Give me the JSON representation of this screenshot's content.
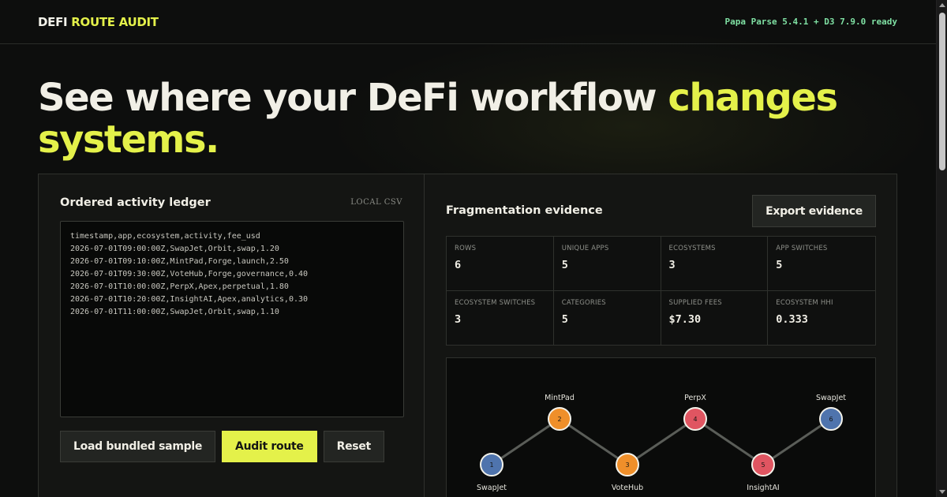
{
  "app": {
    "brand_prefix": "DEFI",
    "brand_accent": "ROUTE AUDIT",
    "library_status": "Papa Parse 5.4.1 + D3 7.9.0 ready"
  },
  "hero": {
    "headline_main": "See where your DeFi workflow ",
    "headline_accent": "changes systems."
  },
  "ledger": {
    "title": "Ordered activity ledger",
    "source_tag": "LOCAL CSV",
    "csv_text": "timestamp,app,ecosystem,activity,fee_usd\n2026-07-01T09:00:00Z,SwapJet,Orbit,swap,1.20\n2026-07-01T09:10:00Z,MintPad,Forge,launch,2.50\n2026-07-01T09:30:00Z,VoteHub,Forge,governance,0.40\n2026-07-01T10:00:00Z,PerpX,Apex,perpetual,1.80\n2026-07-01T10:20:00Z,InsightAI,Apex,analytics,0.30\n2026-07-01T11:00:00Z,SwapJet,Orbit,swap,1.10",
    "buttons": {
      "load_sample": "Load bundled sample",
      "audit": "Audit route",
      "reset": "Reset"
    }
  },
  "evidence": {
    "title": "Fragmentation evidence",
    "export_label": "Export evidence",
    "stats": [
      {
        "label": "ROWS",
        "value": "6"
      },
      {
        "label": "UNIQUE APPS",
        "value": "5"
      },
      {
        "label": "ECOSYSTEMS",
        "value": "3"
      },
      {
        "label": "APP SWITCHES",
        "value": "5"
      },
      {
        "label": "ECOSYSTEM SWITCHES",
        "value": "3"
      },
      {
        "label": "CATEGORIES",
        "value": "5"
      },
      {
        "label": "SUPPLIED FEES",
        "value": "$7.30"
      },
      {
        "label": "ECOSYSTEM HHI",
        "value": "0.333"
      }
    ]
  },
  "route": {
    "colors": {
      "Orbit": "#4f74ad",
      "Forge": "#ef8f2a",
      "Apex": "#e05561"
    },
    "steps": [
      {
        "n": "1",
        "app": "SwapJet",
        "ecosystem": "Orbit"
      },
      {
        "n": "2",
        "app": "MintPad",
        "ecosystem": "Forge"
      },
      {
        "n": "3",
        "app": "VoteHub",
        "ecosystem": "Forge"
      },
      {
        "n": "4",
        "app": "PerpX",
        "ecosystem": "Apex"
      },
      {
        "n": "5",
        "app": "InsightAI",
        "ecosystem": "Apex"
      },
      {
        "n": "6",
        "app": "SwapJet",
        "ecosystem": "Orbit"
      }
    ]
  }
}
